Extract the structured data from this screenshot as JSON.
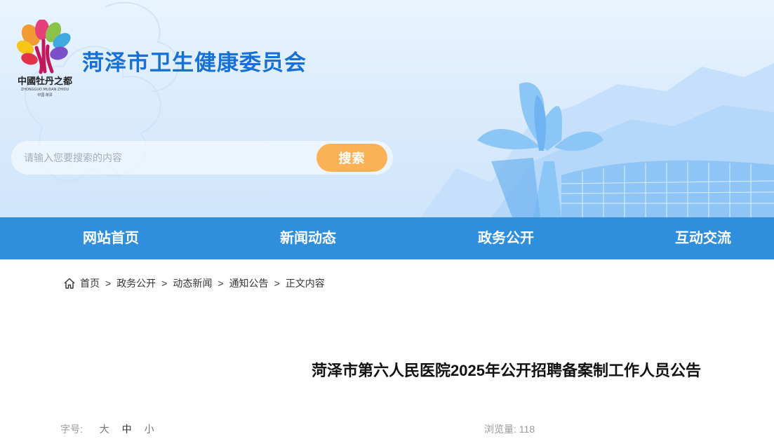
{
  "site": {
    "title": "菏泽市卫生健康委员会",
    "logo_text": "中國牡丹之都",
    "logo_subtext": "ZHONGGUO MUDAN ZHIDU",
    "logo_caption": "中国·菏泽"
  },
  "search": {
    "placeholder": "请输入您要搜索的内容",
    "value": "",
    "button_label": "搜索"
  },
  "nav": {
    "items": [
      {
        "label": "网站首页"
      },
      {
        "label": "新闻动态"
      },
      {
        "label": "政务公开"
      },
      {
        "label": "互动交流"
      }
    ]
  },
  "breadcrumb": {
    "items": [
      "首页",
      "政务公开",
      "动态新闻",
      "通知公告",
      "正文内容"
    ],
    "separator": ">"
  },
  "article": {
    "title": "菏泽市第六人民医院2025年公开招聘备案制工作人员公告",
    "font_size_label": "字号:",
    "font_size_options": [
      "大",
      "中",
      "小"
    ],
    "views_label": "浏览量:",
    "views_count": "118"
  },
  "colors": {
    "brand": "#1670d6",
    "nav_bg": "#2f8fdd",
    "search_button": "#fbb257",
    "banner_bg": "#dcecfd"
  },
  "icons": {
    "home": "home-icon",
    "logo": "peony-logo-icon"
  }
}
